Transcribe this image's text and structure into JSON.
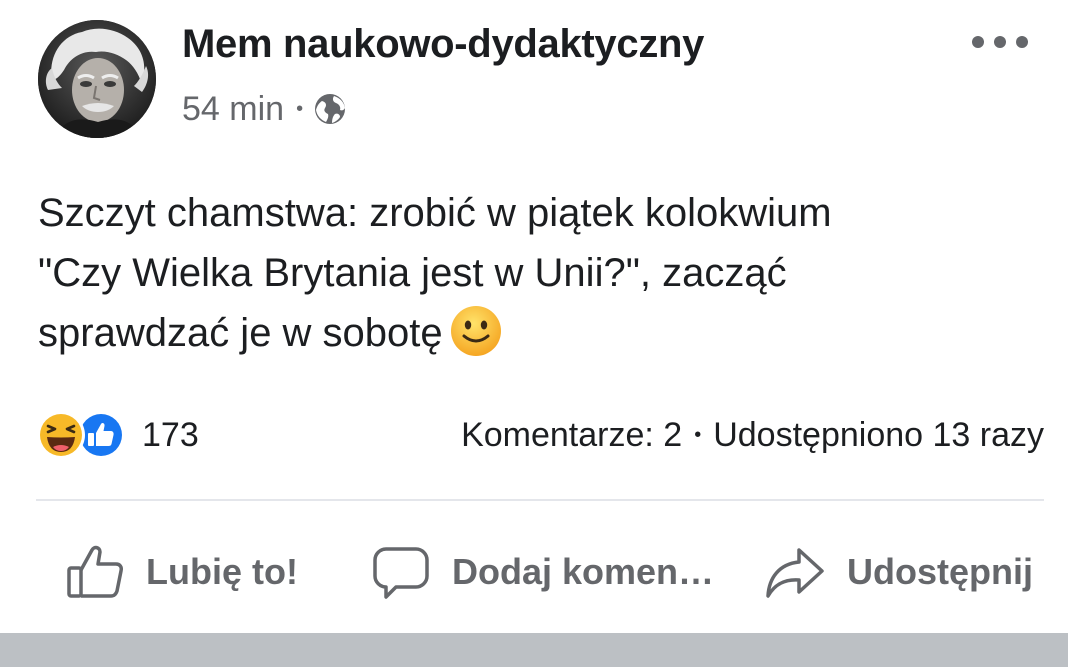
{
  "post": {
    "page_name": "Mem naukowo-dydaktyczny",
    "time": "54 min",
    "privacy_icon": "globe-icon",
    "more_icon": "more-options-icon",
    "text_line1": "Szczyt chamstwa: zrobić w piątek kolokwium",
    "text_line2": "\"Czy Wielka Brytania jest w Unii?\", zacząć",
    "text_line3": "sprawdzać je w sobotę",
    "text_emoji": "slightly-smiling-face-emoji"
  },
  "reactions": {
    "icons": [
      "haha-reaction-icon",
      "like-reaction-icon"
    ],
    "count": "173"
  },
  "stats": {
    "comments": "Komentarze: 2",
    "shares": "Udostępniono 13 razy"
  },
  "actions": {
    "like_label": "Lubię to!",
    "comment_label": "Dodaj komen…",
    "share_label": "Udostępnij"
  },
  "colors": {
    "text": "#1c1e21",
    "secondary": "#65676b",
    "like_blue": "#1877f2",
    "haha_yellow": "#f7b928",
    "divider": "#e4e6eb",
    "footer": "#bcc0c4"
  }
}
